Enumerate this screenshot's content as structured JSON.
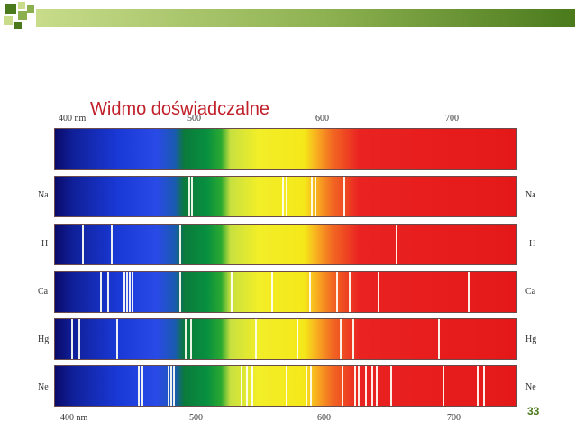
{
  "slide": {
    "title": "Widmo doświadczalne",
    "page_number": "33",
    "accent_color": "#c0202a",
    "bar_colors": [
      "#4a7a1c",
      "#c8dc8a"
    ]
  },
  "figure": {
    "top_scale": [
      "400 nm",
      "500",
      "600",
      "700"
    ],
    "bottom_scale": [
      "400 nm",
      "500",
      "600",
      "700"
    ],
    "elements": [
      {
        "left": "",
        "right": "",
        "lines": []
      },
      {
        "left": "Na",
        "right": "Na",
        "lines": [
          148,
          151,
          252,
          256,
          284,
          288,
          320
        ]
      },
      {
        "left": "H",
        "right": "H",
        "lines": [
          30,
          62,
          138,
          378
        ]
      },
      {
        "left": "Ca",
        "right": "Ca",
        "lines": [
          50,
          58,
          76,
          79,
          82,
          85,
          138,
          195,
          240,
          282,
          312,
          326,
          358,
          458
        ]
      },
      {
        "left": "Hg",
        "right": "Hg",
        "lines": [
          18,
          26,
          68,
          144,
          150,
          222,
          268,
          316,
          330,
          425
        ]
      },
      {
        "left": "Ne",
        "right": "Ne",
        "lines": [
          92,
          96,
          125,
          128,
          131,
          206,
          212,
          218,
          256,
          278,
          283,
          318,
          332,
          336,
          344,
          351,
          356,
          372,
          430,
          468,
          475
        ]
      }
    ]
  }
}
